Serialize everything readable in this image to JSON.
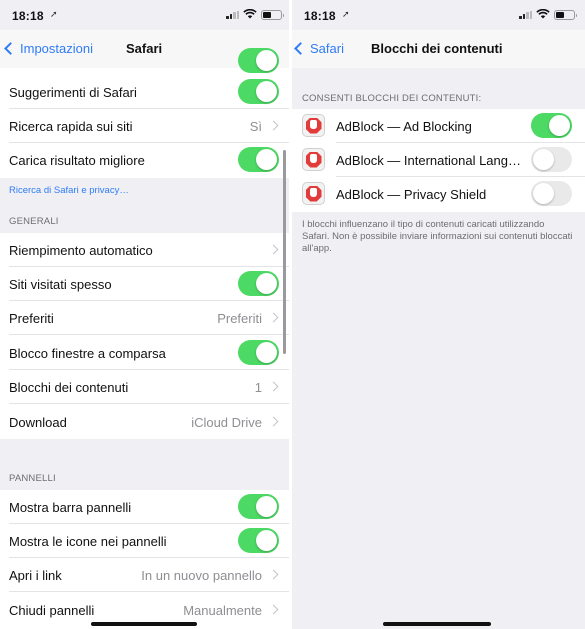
{
  "left": {
    "status": {
      "time": "18:18"
    },
    "nav": {
      "back_label": "Impostazioni",
      "title": "Safari"
    },
    "search_rows": [
      {
        "label": "Suggerimenti di Safari",
        "toggle": true
      },
      {
        "label": "Ricerca rapida sui siti",
        "value": "Sì"
      },
      {
        "label": "Carica risultato migliore",
        "toggle": true
      }
    ],
    "privacy_link": "Ricerca di Safari e privacy…",
    "general_header": "GENERALI",
    "general_rows": [
      {
        "label": "Riempimento automatico",
        "value": ""
      },
      {
        "label": "Siti visitati spesso",
        "toggle": true
      },
      {
        "label": "Preferiti",
        "value": "Preferiti"
      },
      {
        "label": "Blocco finestre a comparsa",
        "toggle": true
      },
      {
        "label": "Blocchi dei contenuti",
        "value": "1"
      },
      {
        "label": "Download",
        "value": "iCloud Drive"
      }
    ],
    "tabs_header": "PANNELLI",
    "tabs_rows": [
      {
        "label": "Mostra barra pannelli",
        "toggle": true
      },
      {
        "label": "Mostra le icone nei pannelli",
        "toggle": true
      },
      {
        "label": "Apri i link",
        "value": "In un nuovo pannello"
      },
      {
        "label": "Chiudi pannelli",
        "value": "Manualmente"
      }
    ]
  },
  "right": {
    "status": {
      "time": "18:18"
    },
    "nav": {
      "back_label": "Safari",
      "title": "Blocchi dei contenuti"
    },
    "section_header": "CONSENTI BLOCCHI DEI CONTENUTI:",
    "extensions": [
      {
        "label": "AdBlock — Ad Blocking",
        "enabled": true,
        "icon": "adblock-hand-icon"
      },
      {
        "label": "AdBlock — International Lang…",
        "enabled": false,
        "icon": "adblock-hand-icon"
      },
      {
        "label": "AdBlock — Privacy Shield",
        "enabled": false,
        "icon": "adblock-hand-icon"
      }
    ],
    "footer": "I blocchi influenzano il tipo di contenuti caricati utilizzando Safari. Non è possibile inviare informazioni sui contenuti bloccati all'app."
  },
  "colors": {
    "accent": "#2f7cf6",
    "toggle_on": "#4cd964",
    "toggle_off": "#e9e9ea",
    "background": "#efeff4",
    "adblock_red": "#e23b3b"
  }
}
